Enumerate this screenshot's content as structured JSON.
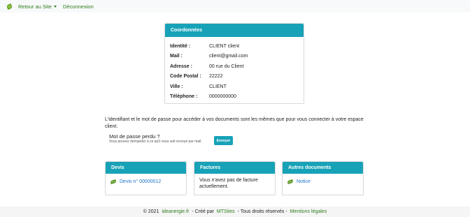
{
  "nav": {
    "back_label": "Retour au Site",
    "logout_label": "Déconnexion"
  },
  "coordinates": {
    "title": "Coordonnées",
    "rows": [
      {
        "label": "Identité :",
        "value": "CLIENT client"
      },
      {
        "label": "Mail :",
        "value": "client@gmail.com"
      },
      {
        "label": "Adresse :",
        "value": "00 rue du Client"
      },
      {
        "label": "Code Postal :",
        "value": "22222"
      },
      {
        "label": "Ville :",
        "value": "CLIENT"
      },
      {
        "label": "Téléphone :",
        "value": "0000000000"
      }
    ]
  },
  "info_text": "L'identifiant et le mot de passe pour accéder à vos documents sont les mêmes que pour vous connecter à votre espace client.",
  "password": {
    "title": "Mot de passe perdu ?",
    "subtitle": "Vous pouvez demander à ce qu'il vous soit envoyé par mail.",
    "button": "Envoyer"
  },
  "cards": {
    "devis": {
      "title": "Devis",
      "link": "Devis n° 00000012"
    },
    "factures": {
      "title": "Factures",
      "text": "Vous n'avez pas de facture actuellement."
    },
    "autres": {
      "title": "Autres documents",
      "link": "Notice"
    }
  },
  "footer": {
    "copyright": "© 2021",
    "site": "ideanergie.fr",
    "created_by": "- Créé par",
    "author": "MTSites",
    "rights": "- Tous droits réservés -",
    "legal": "Mentions légales"
  },
  "colors": {
    "accent": "#17a2b8",
    "link_green": "#2e7d1e",
    "link_blue": "#1a73c8"
  }
}
